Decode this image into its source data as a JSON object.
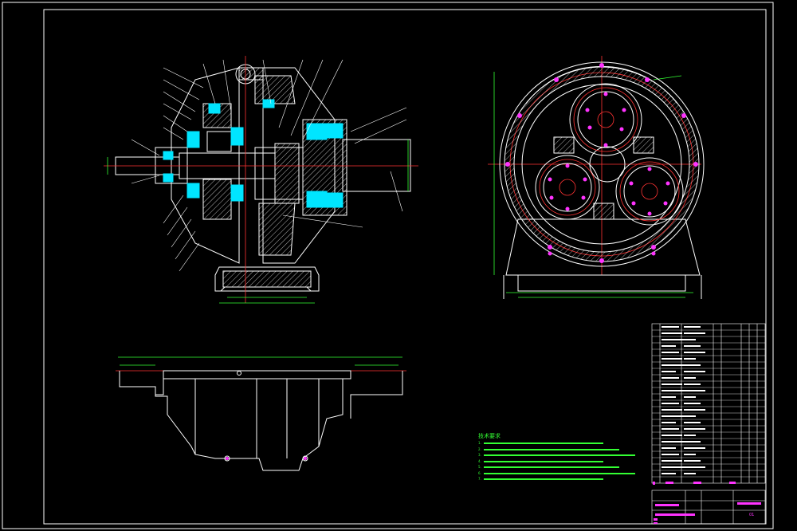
{
  "drawing": {
    "background": "#000000",
    "frame_color": "#ffffff",
    "section_color": "#ffffff",
    "centerline_color": "#ff3333",
    "dimension_color": "#33ff33",
    "bearing_color": "#00e5ff",
    "hole_color": "#ff33ff",
    "views": [
      "front-section-view",
      "side-view",
      "top-view"
    ]
  },
  "notes": {
    "title": "技术要求",
    "lines": [
      "1.",
      "2.",
      "3.",
      "4.",
      "5.",
      "6.",
      "7."
    ]
  },
  "title_block": {
    "drawing_code": "01"
  }
}
